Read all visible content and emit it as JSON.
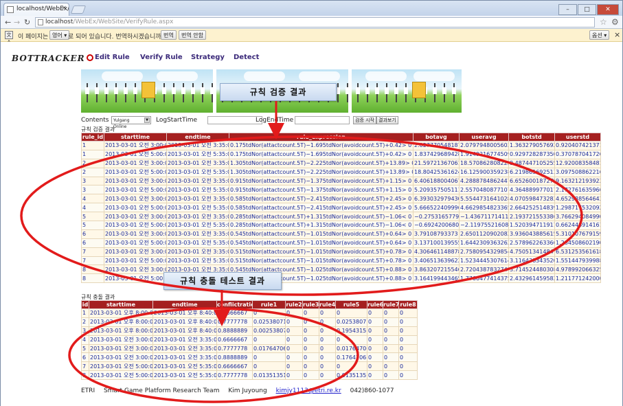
{
  "browser": {
    "tab_title": "localhost/WebEx/WebSit",
    "url_host": "localhost",
    "url_path": "/WebEx/WebSite/VerifyRule.aspx",
    "translate": {
      "prefix": "이 페이지는",
      "language": "영어 ▾",
      "suffix": "로 되어 있습니다. 번역하시겠습니까?",
      "translate_btn": "번역",
      "no_translate_btn": "번역 안함",
      "options_btn": "옵션 ▾"
    }
  },
  "site": {
    "logo": "BOTTRACKER",
    "menu": [
      "Edit Rule",
      "Verify Rule",
      "Strategy",
      "Detect"
    ]
  },
  "filters": {
    "contents_label": "Contents",
    "contents_value": "Yulgang Online",
    "start_label": "LogStartTime",
    "end_label": "LogEndTime",
    "verify_btn": "검증 시작",
    "view_btn": "결과보기"
  },
  "callouts": {
    "verify_result": "규칙 검증 결과",
    "conflict_result": "규칙 충돌 테스트 결과"
  },
  "verify": {
    "section_title": "규칙 검증 결과",
    "columns": [
      "rule_id",
      "starttime",
      "endtime",
      "rule_expression",
      "botavg",
      "useravg",
      "botstd",
      "userstd"
    ],
    "rows": [
      [
        "1",
        "2013-03-01 오전 3:00:00",
        "2013-03-01 오전 3:35:00",
        "0.175tdNor(attactcount.5T)−1.695tdNor(avoidcount.5T)+0.42> 0",
        "2.0277705481878",
        "2.07979480056031",
        "1.36327905769246",
        "0.920407421371125"
      ],
      [
        "1",
        "2013-03-01 오전 5:00:00",
        "2013-03-01 오전 5:35:00",
        "0.175tdNor(attactcount.5T)−1.695tdNor(avoidcount.5T)+0.42> 0",
        "1.83742968942853",
        "1.91492167745097",
        "0.929728287350164",
        "0.370787041726029"
      ],
      [
        "2",
        "2013-03-01 오전 3:00:00",
        "2013-03-01 오전 3:35:00",
        "1.305tdNor(attactcount.5T)−2.225tdNor(avoidcount.5T)+13.89> 0",
        "21.5972136706156",
        "18.5708628082227",
        "9.487447105255",
        "12.9200835848133"
      ],
      [
        "2",
        "2013-03-01 오전 5:00:00",
        "2013-03-01 오전 5:35:00",
        "1.305tdNor(attactcount.5T)−2.225tdNor(avoidcount.5T)+13.89> 0",
        "18.8042536162459",
        "16.1259003592385",
        "6.21986569251313",
        "3.09750886221646"
      ],
      [
        "3",
        "2013-03-01 오전 3:00:00",
        "2013-03-01 오전 3:35:00",
        "0.915tdNor(attactcount.5T)−1.375tdNor(avoidcount.5T)+1.15> 0",
        "6.40618800406764",
        "4.28887848624475",
        "6.65260018727562",
        "9.16321219392356"
      ],
      [
        "3",
        "2013-03-01 오전 5:00:00",
        "2013-03-01 오전 5:35:00",
        "0.915tdNor(attactcount.5T)−1.375tdNor(avoidcount.5T)+1.15> 0",
        "5.20935750511102",
        "2.55704808771074",
        "4.36488997701705",
        "2.17276163596622"
      ],
      [
        "4",
        "2013-03-01 오전 3:00:00",
        "2013-03-01 오전 3:35:00",
        "0.585tdNor(attactcount.5T)−2.415tdNor(avoidcount.5T)+2.45> 0",
        "6.39303297943049",
        "5.55447316410285",
        "4.07059847328387",
        "4.65298856464373"
      ],
      [
        "4",
        "2013-03-01 오전 5:00:00",
        "2013-03-01 오전 5:35:00",
        "0.585tdNor(attactcount.5T)−2.415tdNor(avoidcount.5T)+2.45> 0",
        "5.66652240999689",
        "4.66298548233653",
        "2.6642525148392",
        "1.298717532092"
      ],
      [
        "5",
        "2013-03-01 오전 3:00:00",
        "2013-03-01 오전 3:35:00",
        "0.285tdNor(attactcount.5T)+1.315tdNor(avoidcount.5T)−1.06< 0",
        "−0.275316577906798",
        "−1.43671171411694",
        "2.19372155338677",
        "3.76629408499076"
      ],
      [
        "5",
        "2013-03-01 오전 5:00:00",
        "2013-03-01 오전 5:35:00",
        "0.285tdNor(attactcount.5T)+1.315tdNor(avoidcount.5T)−1.06< 0",
        "−0.692420068037741",
        "−2.11975521608694",
        "1.52039471191143",
        "0.66244891416114"
      ],
      [
        "6",
        "2013-03-01 오전 3:00:00",
        "2013-03-01 오전 3:35:00",
        "0.545tdNor(attactcount.5T)−1.015tdNor(avoidcount.5T)+0.64> 0",
        "3.79108793373",
        "2.65011209020827",
        "3.93604388561544",
        "5.31010767915901"
      ],
      [
        "6",
        "2013-03-01 오전 5:00:00",
        "2013-03-01 오전 5:35:00",
        "0.545tdNor(attactcount.5T)−1.015tdNor(avoidcount.5T)+0.64> 0",
        "3.13710013955551",
        "1.64423093632622",
        "2.57896226336667",
        "1.28450860219003"
      ],
      [
        "7",
        "2013-03-01 오전 3:00:00",
        "2013-03-01 오전 3:35:00",
        "0.515tdNor(attactcount.5T)−1.015tdNor(avoidcount.5T)+0.78> 0",
        "4.30646114887837",
        "2.75809543298543",
        "4.75051341484726",
        "6.53125356161835"
      ],
      [
        "7",
        "2013-03-01 오전 5:00:00",
        "2013-03-01 오전 5:35:00",
        "0.515tdNor(attactcount.5T)−1.015tdNor(avoidcount.5T)+0.78> 0",
        "3.40651363962214",
        "1.52344453076148",
        "3.11643834352005",
        "1.55144793998851"
      ],
      [
        "8",
        "2013-03-01 오전 3:00:00",
        "2013-03-01 오전 3:35:00",
        "0.545tdNor(attactcount.5T)−1.025tdNor(avoidcount.5T)+0.88> 0",
        "3.86320721554627",
        "2.72043878327417",
        "3.71452448030875",
        "4.97899206632531"
      ],
      [
        "8",
        "2013-03-01 오전 5:00:00",
        "2013-03-01 오전 5:35:00",
        "0.545tdNor(attactcount.5T)−1.025tdNor(avoidcount.5T)+0.88> 0",
        "3.16419944346588",
        "1.77664774143753",
        "2.43296145958233",
        "1.21177124200093"
      ]
    ]
  },
  "conflict": {
    "section_title": "규칙 충돌 결과",
    "columns": [
      "id",
      "starttime",
      "endtime",
      "conflictratio",
      "rule1",
      "rule2",
      "rule3",
      "rule4",
      "rule5",
      "rule6",
      "rule7",
      "rule8"
    ],
    "rows": [
      [
        "1",
        "2013-03-01 오후 8:00:00",
        "2013-03-01 오후 8:40:00",
        "0.6666667",
        "0",
        "0",
        "0",
        "0",
        "0",
        "0",
        "0",
        "0"
      ],
      [
        "2",
        "2013-03-01 오후 8:00:00",
        "2013-03-01 오후 8:40:00",
        "0.7777778",
        "0.02538071",
        "0",
        "0",
        "0",
        "0.02538071",
        "0",
        "0",
        "0"
      ],
      [
        "3",
        "2013-03-01 오후 8:00:00",
        "2013-03-01 오후 8:40:00",
        "0.8888889",
        "0.002538071",
        "0",
        "0",
        "0",
        "0.1954315",
        "0",
        "0",
        "0"
      ],
      [
        "4",
        "2013-03-01 오전 3:00:00",
        "2013-03-01 오전 3:35:00",
        "0.6666667",
        "0",
        "0",
        "0",
        "0",
        "0",
        "0",
        "0",
        "0"
      ],
      [
        "5",
        "2013-03-01 오전 3:00:00",
        "2013-03-01 오전 3:35:00",
        "0.7777778",
        "0.01764706",
        "0",
        "0",
        "0",
        "0.01764706",
        "0",
        "0",
        "0"
      ],
      [
        "6",
        "2013-03-01 오전 3:00:00",
        "2013-03-01 오전 3:35:00",
        "0.8888889",
        "0",
        "0",
        "0",
        "0",
        "0.1764706",
        "0",
        "0",
        "0"
      ],
      [
        "7",
        "2013-03-01 오전 5:00:00",
        "2013-03-01 오전 5:35:00",
        "0.6666667",
        "0",
        "0",
        "0",
        "0",
        "0",
        "0",
        "0",
        "0"
      ],
      [
        "8",
        "2013-03-01 오전 5:00:00",
        "2013-03-01 오전 5:35:00",
        "0.7777778",
        "0.01351351",
        "0",
        "0",
        "0",
        "0.01351351",
        "0",
        "0",
        "0"
      ]
    ]
  },
  "footer": {
    "org": "ETRI",
    "team": "Smart Game Platform Research Team",
    "name": "Kim Juyoung",
    "email": "kimjy1113@etri.re.kr",
    "phone": "042)860-1077"
  }
}
